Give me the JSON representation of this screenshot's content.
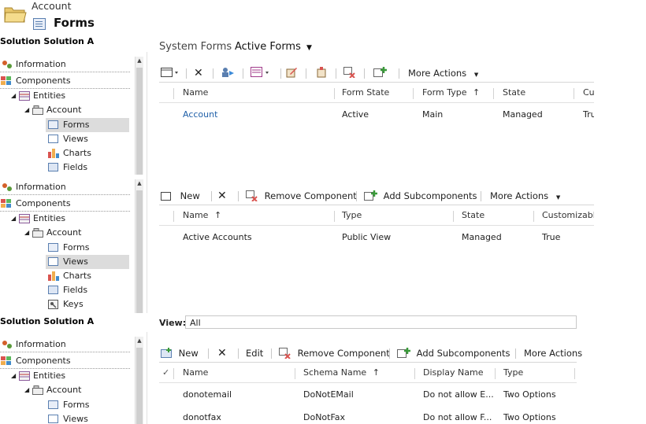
{
  "header": {
    "entity": "Account",
    "page": "Forms"
  },
  "solution_title": "Solution Solution A",
  "tree": {
    "information": "Information",
    "components": "Components",
    "entities": "Entities",
    "account": "Account",
    "forms": "Forms",
    "views": "Views",
    "charts": "Charts",
    "fields": "Fields",
    "keys": "Keys"
  },
  "forms_panel": {
    "system_label": "System Forms",
    "view_selector": "Active Forms",
    "toolbar": {
      "more_actions": "More Actions"
    },
    "columns": [
      "Name",
      "Form State",
      "Form Type",
      "State",
      "Cu"
    ],
    "rows": [
      {
        "name": "Account",
        "form_state": "Active",
        "form_type": "Main",
        "state": "Managed",
        "cu": "Tru"
      }
    ]
  },
  "views_panel": {
    "toolbar": {
      "new": "New",
      "remove_component": "Remove Component",
      "add_subcomponents": "Add Subcomponents",
      "more_actions": "More Actions"
    },
    "columns": [
      "Name",
      "Type",
      "State",
      "Customizabl"
    ],
    "rows": [
      {
        "name": "Active Accounts",
        "type": "Public View",
        "state": "Managed",
        "customizable": "True"
      }
    ]
  },
  "fields_panel": {
    "view_label": "View:",
    "view_value": "All",
    "toolbar": {
      "new": "New",
      "edit": "Edit",
      "remove_component": "Remove Component",
      "add_subcomponents": "Add Subcomponents",
      "more_actions": "More Actions"
    },
    "columns": [
      "Name",
      "Schema Name",
      "Display Name",
      "Type"
    ],
    "rows": [
      {
        "name": "donotemail",
        "schema": "DoNotEMail",
        "display": "Do not allow E...",
        "type": "Two Options"
      },
      {
        "name": "donotfax",
        "schema": "DoNotFax",
        "display": "Do not allow F...",
        "type": "Two Options"
      }
    ]
  }
}
